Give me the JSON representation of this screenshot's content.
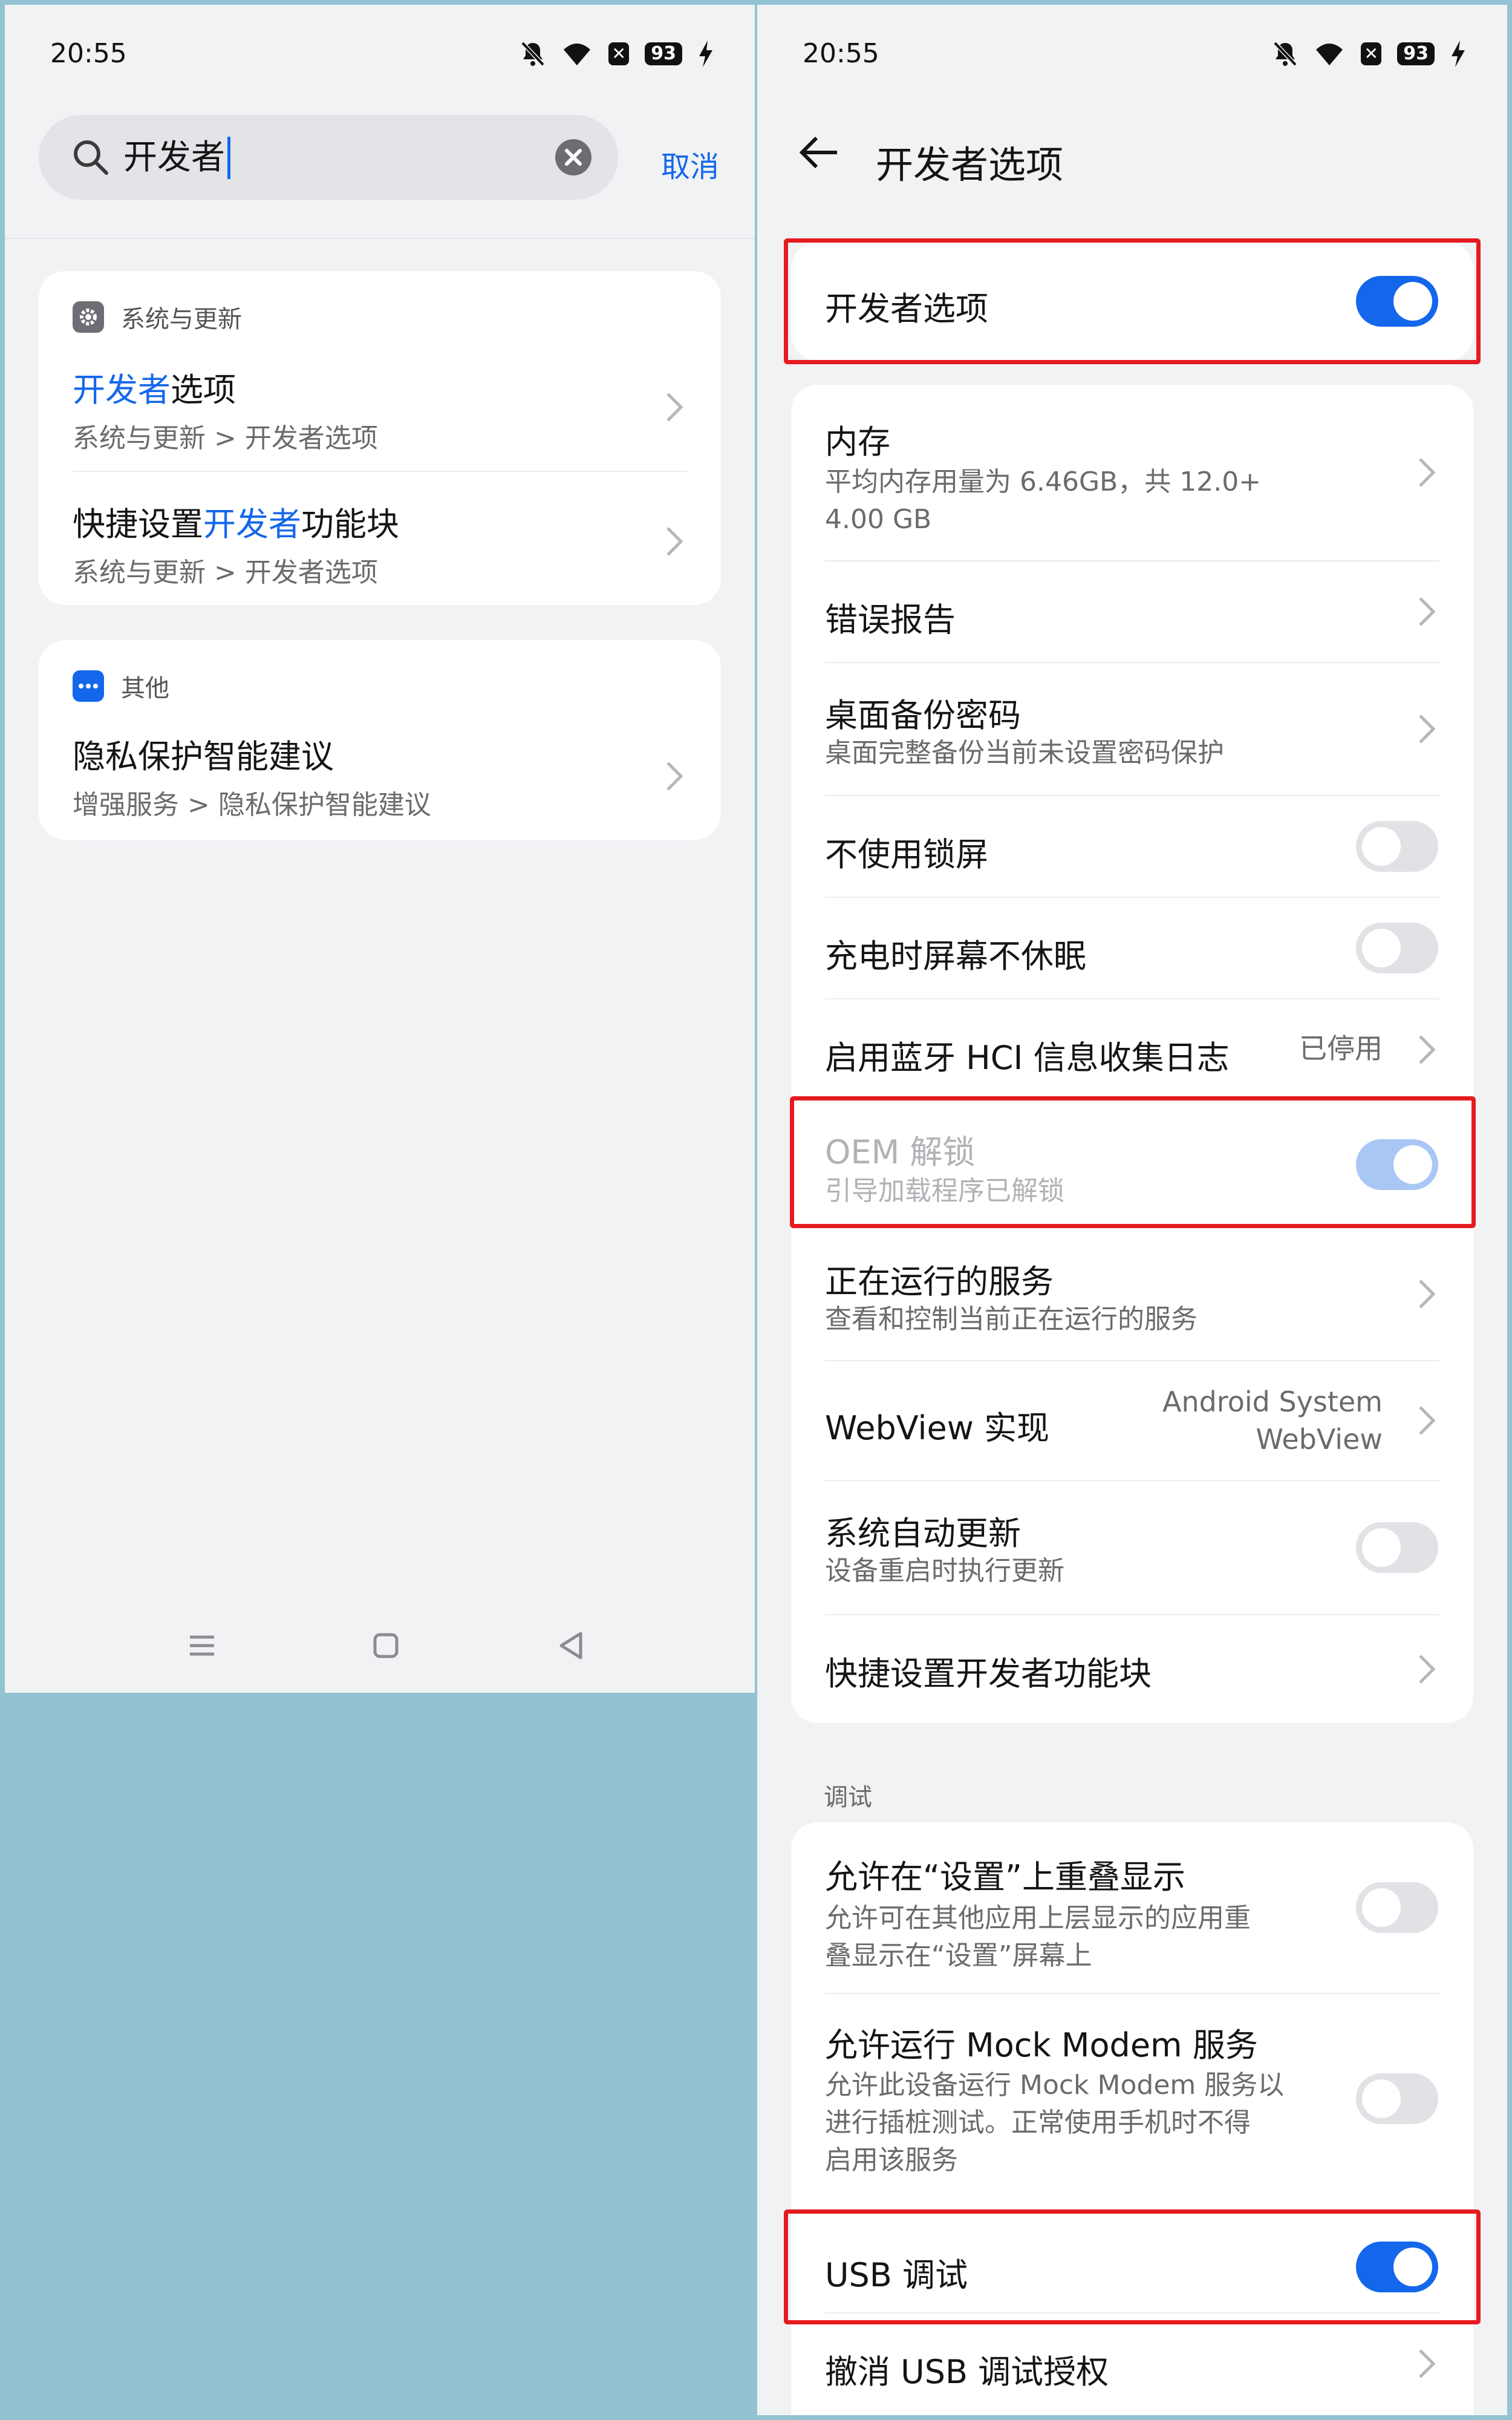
{
  "status": {
    "time": "20:55",
    "battery": "93",
    "icons": [
      "bell-muted-icon",
      "wifi-icon",
      "x-badge-icon",
      "battery-icon",
      "charging-icon"
    ]
  },
  "search_screen": {
    "query": "开发者",
    "cancel_label": "取消",
    "groups": [
      {
        "category": "系统与更新",
        "icon": "gear-icon",
        "items": [
          {
            "title_hl": "开发者",
            "title_rest": "选项",
            "path": "系统与更新 > 开发者选项"
          },
          {
            "title_pre": "快捷设置",
            "title_hl": "开发者",
            "title_rest": "功能块",
            "path": "系统与更新 > 开发者选项"
          }
        ]
      },
      {
        "category": "其他",
        "icon": "more-dots-icon",
        "items": [
          {
            "title": "隐私保护智能建议",
            "path": "增强服务 > 隐私保护智能建议"
          }
        ]
      }
    ]
  },
  "developer_screen": {
    "title": "开发者选项",
    "master_toggle": {
      "label": "开发者选项",
      "on": true
    },
    "items": [
      {
        "title": "内存",
        "sub": "平均内存用量为 6.46GB，共 12.0+",
        "sub2": "4.00 GB",
        "control": "chevron"
      },
      {
        "title": "错误报告",
        "control": "chevron"
      },
      {
        "title": "桌面备份密码",
        "sub": "桌面完整备份当前未设置密码保护",
        "control": "chevron"
      },
      {
        "title": "不使用锁屏",
        "control": "toggle",
        "on": false
      },
      {
        "title": "充电时屏幕不休眠",
        "control": "toggle",
        "on": false
      },
      {
        "title": "启用蓝牙 HCI 信息收集日志",
        "value": "已停用",
        "control": "chevron"
      },
      {
        "title": "OEM 解锁",
        "sub": "引导加载程序已解锁",
        "control": "toggle",
        "on": true,
        "disabled": true
      },
      {
        "title": "正在运行的服务",
        "sub": "查看和控制当前正在运行的服务",
        "control": "chevron"
      },
      {
        "title": "WebView 实现",
        "value": "Android System",
        "value2": "WebView",
        "control": "chevron"
      },
      {
        "title": "系统自动更新",
        "sub": "设备重启时执行更新",
        "control": "toggle",
        "on": false
      },
      {
        "title": "快捷设置开发者功能块",
        "control": "chevron"
      }
    ],
    "debug_section": {
      "label": "调试",
      "items": [
        {
          "title": "允许在“设置”上重叠显示",
          "sub": "允许可在其他应用上层显示的应用重",
          "sub2": "叠显示在“设置”屏幕上",
          "control": "toggle",
          "on": false
        },
        {
          "title": "允许运行 Mock Modem 服务",
          "sub": "允许此设备运行 Mock Modem 服务以",
          "sub2": "进行插桩测试。正常使用手机时不得",
          "sub3": "启用该服务",
          "control": "toggle",
          "on": false
        },
        {
          "title": "USB 调试",
          "control": "toggle",
          "on": true
        },
        {
          "title": "撤消 USB 调试授权",
          "control": "chevron"
        }
      ]
    }
  },
  "colors": {
    "accent": "#1467eb",
    "highlight_box": "#e51b20",
    "panel_bg": "#f1f2f4",
    "outer_bg": "#93c3d3"
  }
}
